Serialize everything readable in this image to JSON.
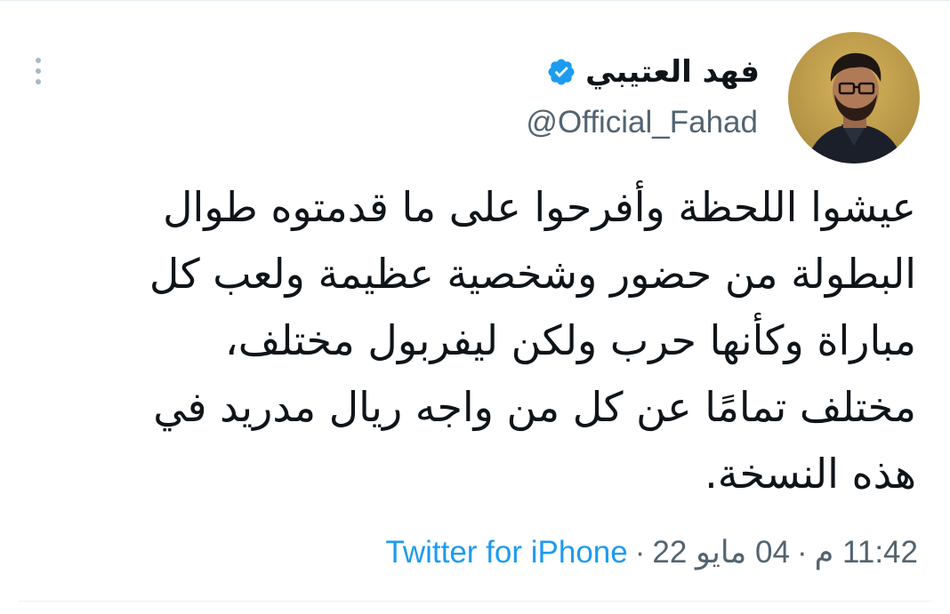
{
  "tweet": {
    "display_name": "فهد العتيبي",
    "verified": true,
    "handle": "@Official_Fahad",
    "text_lines": [
      "عيشوا اللحظة وأفرحوا على ما قدمتوه طوال",
      "البطولة من حضور وشخصية عظيمة ولعب كل",
      "مباراة وكأنها حرب ولكن ليفربول مختلف،",
      "مختلف تمامًا عن كل من واجه ريال مدريد في",
      "هذه النسخة."
    ],
    "time": "11:42 م",
    "date": "04 مايو 22",
    "separator": "·",
    "source": "Twitter for iPhone"
  },
  "colors": {
    "text": "#0f1419",
    "secondary": "#536471",
    "link": "#1d9bf0",
    "verified": "#1d9bf0"
  },
  "icons": {
    "more": "vertical-dots-icon",
    "verified": "verified-badge-icon"
  }
}
